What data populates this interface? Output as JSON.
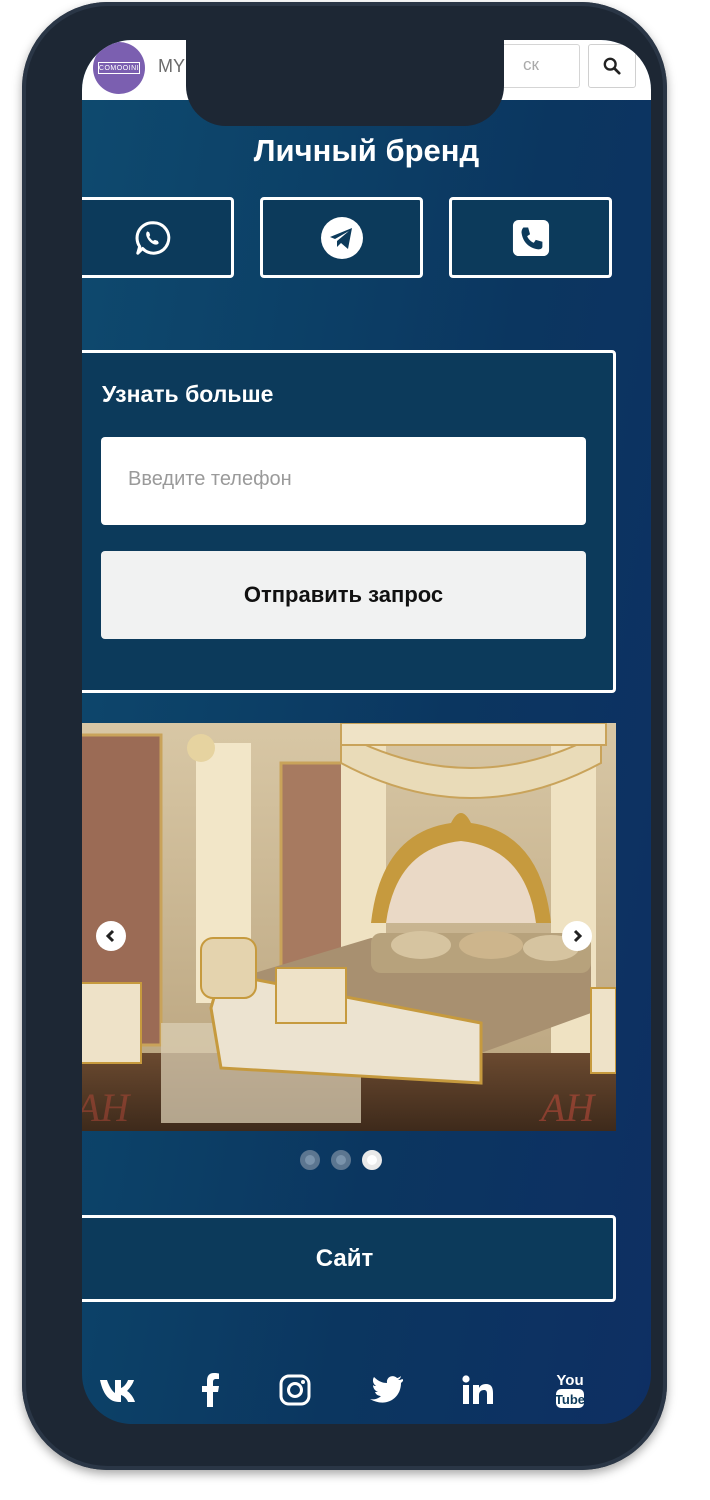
{
  "header": {
    "logo_text": "COMOOINI",
    "brand_label": "MYBR",
    "search_placeholder": "ск",
    "icons": [
      "search-icon"
    ]
  },
  "page": {
    "title": "Личный бренд"
  },
  "contacts": [
    {
      "name": "whatsapp",
      "icon": "whatsapp-icon"
    },
    {
      "name": "telegram",
      "icon": "telegram-icon"
    },
    {
      "name": "phone",
      "icon": "phone-icon"
    }
  ],
  "form": {
    "title": "Узнать больше",
    "phone_placeholder": "Введите телефон",
    "submit_label": "Отправить запрос"
  },
  "carousel": {
    "slide_count": 3,
    "active_slide": 3,
    "icons": [
      "chevron-left-icon",
      "chevron-right-icon"
    ]
  },
  "site_button": {
    "label": "Сайт"
  },
  "social_links": [
    "vk-icon",
    "facebook-icon",
    "instagram-icon",
    "twitter-icon",
    "linkedin-icon",
    "youtube-icon"
  ],
  "youtube_text": [
    "You",
    "Tube"
  ],
  "colors": {
    "background": "#0c3a5b",
    "accent_purple": "#7b5fb0",
    "button_light": "#f1f2f2",
    "phone_frame": "#1d2734"
  }
}
